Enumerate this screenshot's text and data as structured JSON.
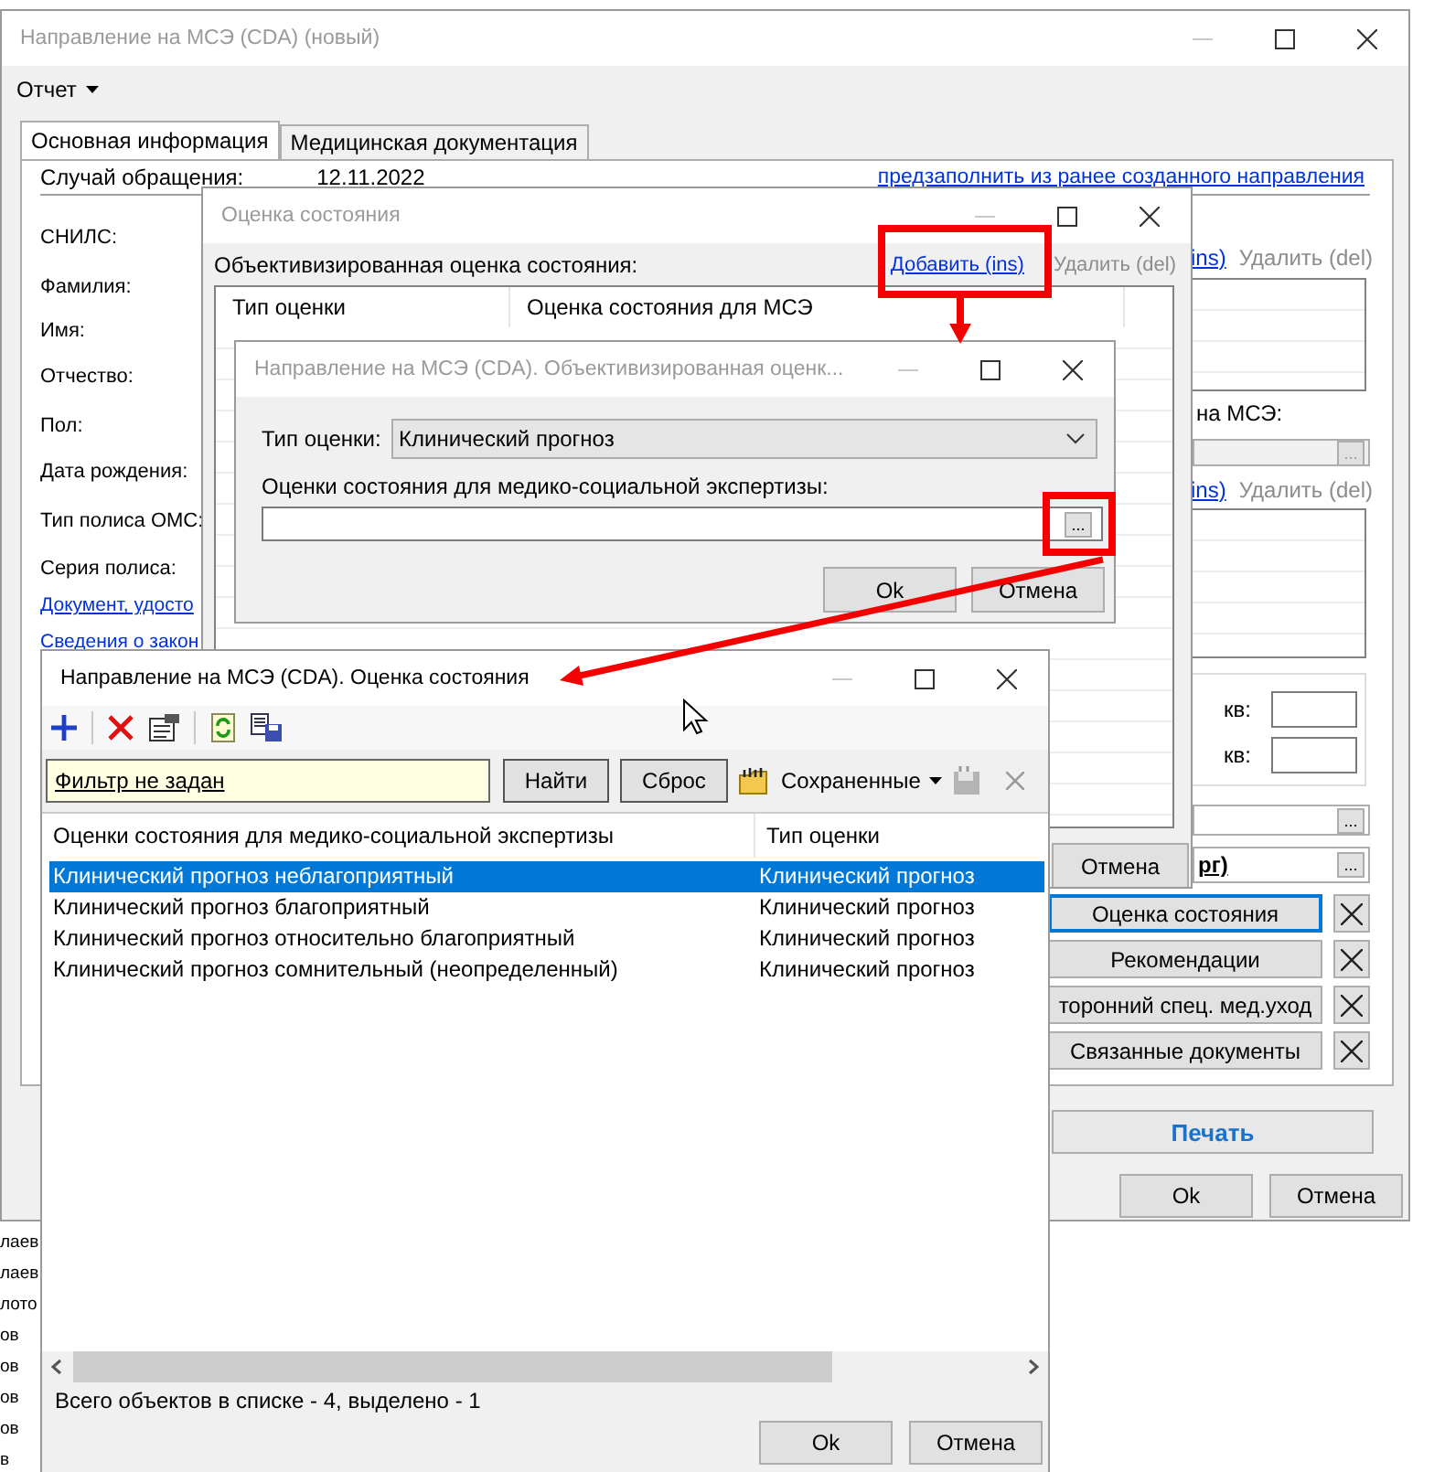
{
  "background_list": {
    "items": [
      "лаев",
      "лаев",
      "лото",
      "ов",
      "ов",
      "ов",
      "ов",
      "в"
    ]
  },
  "main_window": {
    "title": "Направление на МСЭ (CDA) (новый)",
    "active": false,
    "menu": [
      {
        "label": "Отчет"
      }
    ],
    "tabs": [
      {
        "label": "Основная информация",
        "selected": true
      },
      {
        "label": "Медицинская документация",
        "selected": false
      }
    ],
    "case_label": "Случай обращения:",
    "case_date": "12.11.2022",
    "prefill_link": "предзаполнить из ранее созданного направления",
    "labels": [
      "СНИЛС:",
      "Фамилия:",
      "Имя:",
      "Отчество:",
      "Пол:",
      "Дата рождения:",
      "Тип полиса ОМС:",
      "Серия полиса:"
    ],
    "links": [
      "Документ, удосто",
      "Сведения о закон"
    ],
    "list_actions": [
      {
        "add_link": "ins)",
        "delete_link": {
          "label": "Удалить (del)",
          "disabled": true
        }
      },
      {
        "add_link": "ins)",
        "delete_link": {
          "label": "Удалить (del)",
          "disabled": true
        }
      }
    ],
    "referral_label": "на МСЭ:",
    "referral_field": {
      "button": "...",
      "disabled": true
    },
    "apartment_labels": [
      "кв:",
      "кв:"
    ],
    "lookup_fields": [
      {
        "button": "..."
      },
      {
        "value": "рг)",
        "button": "..."
      }
    ],
    "section_buttons": [
      {
        "label": "Оценка состояния",
        "focused": true
      },
      {
        "label": "Рекомендации",
        "focused": false
      },
      {
        "label": "торонний спец. мед.уход",
        "focused": false
      },
      {
        "label": "Связанные документы",
        "focused": false
      }
    ],
    "print_button": "Печать",
    "buttons": [
      "Ok",
      "Отмена"
    ]
  },
  "state_window": {
    "title": "Оценка состояния",
    "active": false,
    "section_label": "Объективизированная оценка состояния:",
    "add_link": "Добавить (ins)",
    "delete_link": {
      "label": "Удалить (del)",
      "disabled": true
    },
    "columns": [
      "Тип оценки",
      "Оценка состояния для МСЭ"
    ],
    "buttons": [
      "Отмена"
    ]
  },
  "assessment_dialog": {
    "title": "Направление на МСЭ (CDA). Объективизированная оценк...",
    "active": false,
    "type_label": "Тип оценки:",
    "type_value": "Клинический прогноз",
    "assessment_label": "Оценки состояния для медико-социальной экспертизы:",
    "browse_button": "...",
    "buttons": [
      "Ok",
      "Отмена"
    ]
  },
  "lookup_window": {
    "title": "Направление на МСЭ (CDA). Оценка состояния",
    "active": true,
    "filter": "Фильтр не задан",
    "find_button": "Найти",
    "reset_button": "Сброс",
    "saved_menu": "Сохраненные",
    "columns": [
      "Оценки состояния для медико-социальной экспертизы",
      "Тип оценки"
    ],
    "rows": [
      {
        "cells": [
          "Клинический прогноз неблагоприятный",
          "Клинический прогноз"
        ],
        "selected": true
      },
      {
        "cells": [
          "Клинический прогноз благоприятный",
          "Клинический прогноз"
        ],
        "selected": false
      },
      {
        "cells": [
          "Клинический прогноз относительно благоприятный",
          "Клинический прогноз"
        ],
        "selected": false
      },
      {
        "cells": [
          "Клинический прогноз сомнительный (неопределенный)",
          "Клинический прогноз"
        ],
        "selected": false
      }
    ],
    "status": "Всего объектов в списке - 4, выделено - 1",
    "buttons": [
      "Ok",
      "Отмена"
    ]
  }
}
